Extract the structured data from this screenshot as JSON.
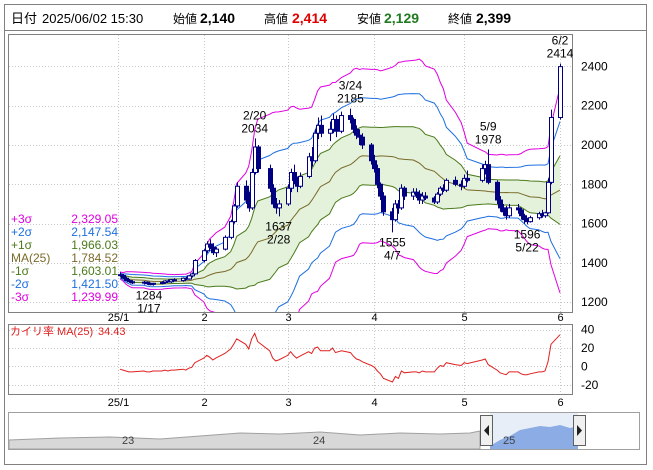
{
  "header": {
    "date_label": "日付",
    "date_value": "2025/06/02 15:30",
    "open_label": "始値",
    "open_value": "2,140",
    "high_label": "高値",
    "high_value": "2,414",
    "low_label": "安値",
    "low_value": "2,129",
    "close_label": "終値",
    "close_value": "2,399"
  },
  "bollinger_legend": [
    {
      "label": "+3σ",
      "value": "2,329.05",
      "color": "#e000e0"
    },
    {
      "label": "+2σ",
      "value": "2,147.54",
      "color": "#1e6fe0"
    },
    {
      "label": "+1σ",
      "value": "1,966.03",
      "color": "#4a7a1a"
    },
    {
      "label": "MA(25)",
      "value": "1,784.52",
      "color": "#7a6a2a"
    },
    {
      "label": "-1σ",
      "value": "1,603.01",
      "color": "#4a7a1a"
    },
    {
      "label": "-2σ",
      "value": "1,421.50",
      "color": "#1e6fe0"
    },
    {
      "label": "-3σ",
      "value": "1,239.99",
      "color": "#e000e0"
    }
  ],
  "deviation_legend": {
    "label": "カイリ率 MA(25)",
    "value": "34.43",
    "color": "#e02020"
  },
  "navigator": {
    "labels": [
      "23",
      "24",
      "25"
    ]
  },
  "chart_data": [
    {
      "type": "candlestick",
      "y_ticks": [
        "1200",
        "1400",
        "1600",
        "1800",
        "2000",
        "2200",
        "2400"
      ],
      "ylim": [
        1150,
        2560
      ],
      "x_ticks": [
        "25/1",
        "2",
        "3",
        "4",
        "5",
        "6"
      ],
      "annotations": [
        {
          "date_text": "1/17",
          "value_text": "1284",
          "x": "2025-01-17",
          "y": 1284
        },
        {
          "date_text": "2/20",
          "value_text": "2034",
          "x": "2025-02-20",
          "y": 2034
        },
        {
          "date_text": "2/28",
          "value_text": "1637",
          "x": "2025-02-28",
          "y": 1637
        },
        {
          "date_text": "3/24",
          "value_text": "2185",
          "x": "2025-03-24",
          "y": 2185
        },
        {
          "date_text": "4/7",
          "value_text": "1555",
          "x": "2025-04-07",
          "y": 1555
        },
        {
          "date_text": "5/9",
          "value_text": "1978",
          "x": "2025-05-09",
          "y": 1978
        },
        {
          "date_text": "5/22",
          "value_text": "1596",
          "x": "2025-05-22",
          "y": 1596
        },
        {
          "date_text": "6/2",
          "value_text": "2414",
          "x": "2025-06-02",
          "y": 2414
        }
      ],
      "candles": [
        {
          "date": "2025-01-06",
          "o": 1340,
          "h": 1352,
          "l": 1330,
          "c": 1336
        },
        {
          "date": "2025-01-07",
          "o": 1336,
          "h": 1344,
          "l": 1318,
          "c": 1322
        },
        {
          "date": "2025-01-08",
          "o": 1322,
          "h": 1330,
          "l": 1306,
          "c": 1310
        },
        {
          "date": "2025-01-09",
          "o": 1310,
          "h": 1318,
          "l": 1298,
          "c": 1304
        },
        {
          "date": "2025-01-10",
          "o": 1304,
          "h": 1312,
          "l": 1292,
          "c": 1298
        },
        {
          "date": "2025-01-14",
          "o": 1298,
          "h": 1308,
          "l": 1290,
          "c": 1302
        },
        {
          "date": "2025-01-15",
          "o": 1302,
          "h": 1306,
          "l": 1288,
          "c": 1294
        },
        {
          "date": "2025-01-16",
          "o": 1294,
          "h": 1300,
          "l": 1286,
          "c": 1292
        },
        {
          "date": "2025-01-17",
          "o": 1292,
          "h": 1298,
          "l": 1284,
          "c": 1296
        },
        {
          "date": "2025-01-20",
          "o": 1296,
          "h": 1306,
          "l": 1290,
          "c": 1300
        },
        {
          "date": "2025-01-21",
          "o": 1300,
          "h": 1312,
          "l": 1294,
          "c": 1308
        },
        {
          "date": "2025-01-22",
          "o": 1308,
          "h": 1316,
          "l": 1300,
          "c": 1304
        },
        {
          "date": "2025-01-23",
          "o": 1304,
          "h": 1318,
          "l": 1298,
          "c": 1314
        },
        {
          "date": "2025-01-24",
          "o": 1314,
          "h": 1322,
          "l": 1306,
          "c": 1310
        },
        {
          "date": "2025-01-27",
          "o": 1310,
          "h": 1326,
          "l": 1304,
          "c": 1322
        },
        {
          "date": "2025-01-28",
          "o": 1322,
          "h": 1330,
          "l": 1312,
          "c": 1318
        },
        {
          "date": "2025-01-29",
          "o": 1318,
          "h": 1338,
          "l": 1314,
          "c": 1334
        },
        {
          "date": "2025-01-30",
          "o": 1334,
          "h": 1350,
          "l": 1326,
          "c": 1344
        },
        {
          "date": "2025-01-31",
          "o": 1344,
          "h": 1420,
          "l": 1340,
          "c": 1412
        },
        {
          "date": "2025-02-03",
          "o": 1412,
          "h": 1470,
          "l": 1402,
          "c": 1462
        },
        {
          "date": "2025-02-04",
          "o": 1462,
          "h": 1510,
          "l": 1450,
          "c": 1496
        },
        {
          "date": "2025-02-05",
          "o": 1496,
          "h": 1520,
          "l": 1470,
          "c": 1480
        },
        {
          "date": "2025-02-06",
          "o": 1480,
          "h": 1500,
          "l": 1440,
          "c": 1452
        },
        {
          "date": "2025-02-07",
          "o": 1452,
          "h": 1480,
          "l": 1430,
          "c": 1470
        },
        {
          "date": "2025-02-10",
          "o": 1470,
          "h": 1540,
          "l": 1464,
          "c": 1530
        },
        {
          "date": "2025-02-12",
          "o": 1530,
          "h": 1620,
          "l": 1520,
          "c": 1610
        },
        {
          "date": "2025-02-13",
          "o": 1610,
          "h": 1700,
          "l": 1600,
          "c": 1690
        },
        {
          "date": "2025-02-14",
          "o": 1690,
          "h": 1810,
          "l": 1680,
          "c": 1790
        },
        {
          "date": "2025-02-17",
          "o": 1790,
          "h": 1820,
          "l": 1700,
          "c": 1720
        },
        {
          "date": "2025-02-18",
          "o": 1720,
          "h": 1760,
          "l": 1660,
          "c": 1680
        },
        {
          "date": "2025-02-19",
          "o": 1680,
          "h": 1880,
          "l": 1670,
          "c": 1860
        },
        {
          "date": "2025-02-20",
          "o": 1860,
          "h": 2034,
          "l": 1850,
          "c": 1990
        },
        {
          "date": "2025-02-21",
          "o": 1990,
          "h": 2000,
          "l": 1860,
          "c": 1880
        },
        {
          "date": "2025-02-25",
          "o": 1880,
          "h": 1900,
          "l": 1760,
          "c": 1780
        },
        {
          "date": "2025-02-26",
          "o": 1780,
          "h": 1800,
          "l": 1680,
          "c": 1700
        },
        {
          "date": "2025-02-27",
          "o": 1700,
          "h": 1730,
          "l": 1650,
          "c": 1680
        },
        {
          "date": "2025-02-28",
          "o": 1680,
          "h": 1720,
          "l": 1637,
          "c": 1700
        },
        {
          "date": "2025-03-03",
          "o": 1700,
          "h": 1800,
          "l": 1690,
          "c": 1780
        },
        {
          "date": "2025-03-04",
          "o": 1780,
          "h": 1880,
          "l": 1760,
          "c": 1860
        },
        {
          "date": "2025-03-05",
          "o": 1860,
          "h": 1900,
          "l": 1800,
          "c": 1820
        },
        {
          "date": "2025-03-06",
          "o": 1820,
          "h": 1840,
          "l": 1760,
          "c": 1790
        },
        {
          "date": "2025-03-07",
          "o": 1790,
          "h": 1860,
          "l": 1780,
          "c": 1840
        },
        {
          "date": "2025-03-10",
          "o": 1840,
          "h": 1960,
          "l": 1830,
          "c": 1940
        },
        {
          "date": "2025-03-11",
          "o": 1940,
          "h": 1990,
          "l": 1890,
          "c": 1920
        },
        {
          "date": "2025-03-12",
          "o": 1920,
          "h": 2080,
          "l": 1910,
          "c": 2060
        },
        {
          "date": "2025-03-13",
          "o": 2060,
          "h": 2140,
          "l": 2030,
          "c": 2100
        },
        {
          "date": "2025-03-14",
          "o": 2100,
          "h": 2150,
          "l": 2040,
          "c": 2060
        },
        {
          "date": "2025-03-17",
          "o": 2060,
          "h": 2120,
          "l": 2020,
          "c": 2080
        },
        {
          "date": "2025-03-18",
          "o": 2080,
          "h": 2160,
          "l": 2060,
          "c": 2130
        },
        {
          "date": "2025-03-19",
          "o": 2130,
          "h": 2150,
          "l": 2040,
          "c": 2070
        },
        {
          "date": "2025-03-21",
          "o": 2070,
          "h": 2170,
          "l": 2060,
          "c": 2150
        },
        {
          "date": "2025-03-24",
          "o": 2150,
          "h": 2185,
          "l": 2110,
          "c": 2130
        },
        {
          "date": "2025-03-25",
          "o": 2130,
          "h": 2140,
          "l": 2060,
          "c": 2080
        },
        {
          "date": "2025-03-26",
          "o": 2080,
          "h": 2100,
          "l": 2030,
          "c": 2050
        },
        {
          "date": "2025-03-27",
          "o": 2050,
          "h": 2080,
          "l": 2000,
          "c": 2040
        },
        {
          "date": "2025-03-28",
          "o": 2040,
          "h": 2060,
          "l": 1980,
          "c": 2000
        },
        {
          "date": "2025-03-31",
          "o": 2000,
          "h": 2010,
          "l": 1900,
          "c": 1920
        },
        {
          "date": "2025-04-01",
          "o": 1920,
          "h": 1950,
          "l": 1860,
          "c": 1880
        },
        {
          "date": "2025-04-02",
          "o": 1880,
          "h": 1900,
          "l": 1780,
          "c": 1800
        },
        {
          "date": "2025-04-03",
          "o": 1800,
          "h": 1810,
          "l": 1720,
          "c": 1740
        },
        {
          "date": "2025-04-04",
          "o": 1740,
          "h": 1760,
          "l": 1640,
          "c": 1660
        },
        {
          "date": "2025-04-07",
          "o": 1660,
          "h": 1680,
          "l": 1555,
          "c": 1620
        },
        {
          "date": "2025-04-08",
          "o": 1620,
          "h": 1720,
          "l": 1610,
          "c": 1700
        },
        {
          "date": "2025-04-09",
          "o": 1700,
          "h": 1720,
          "l": 1650,
          "c": 1680
        },
        {
          "date": "2025-04-10",
          "o": 1680,
          "h": 1800,
          "l": 1670,
          "c": 1780
        },
        {
          "date": "2025-04-11",
          "o": 1780,
          "h": 1790,
          "l": 1720,
          "c": 1740
        },
        {
          "date": "2025-04-14",
          "o": 1740,
          "h": 1780,
          "l": 1720,
          "c": 1760
        },
        {
          "date": "2025-04-15",
          "o": 1760,
          "h": 1780,
          "l": 1730,
          "c": 1750
        },
        {
          "date": "2025-04-16",
          "o": 1750,
          "h": 1770,
          "l": 1700,
          "c": 1720
        },
        {
          "date": "2025-04-17",
          "o": 1720,
          "h": 1760,
          "l": 1700,
          "c": 1740
        },
        {
          "date": "2025-04-18",
          "o": 1740,
          "h": 1760,
          "l": 1720,
          "c": 1730
        },
        {
          "date": "2025-04-21",
          "o": 1730,
          "h": 1740,
          "l": 1700,
          "c": 1710
        },
        {
          "date": "2025-04-22",
          "o": 1710,
          "h": 1760,
          "l": 1700,
          "c": 1750
        },
        {
          "date": "2025-04-23",
          "o": 1750,
          "h": 1790,
          "l": 1740,
          "c": 1780
        },
        {
          "date": "2025-04-24",
          "o": 1780,
          "h": 1800,
          "l": 1760,
          "c": 1770
        },
        {
          "date": "2025-04-25",
          "o": 1770,
          "h": 1830,
          "l": 1760,
          "c": 1820
        },
        {
          "date": "2025-04-28",
          "o": 1820,
          "h": 1840,
          "l": 1790,
          "c": 1800
        },
        {
          "date": "2025-04-30",
          "o": 1800,
          "h": 1820,
          "l": 1770,
          "c": 1790
        },
        {
          "date": "2025-05-01",
          "o": 1790,
          "h": 1850,
          "l": 1780,
          "c": 1830
        },
        {
          "date": "2025-05-02",
          "o": 1830,
          "h": 1870,
          "l": 1810,
          "c": 1820
        },
        {
          "date": "2025-05-07",
          "o": 1820,
          "h": 1900,
          "l": 1810,
          "c": 1880
        },
        {
          "date": "2025-05-08",
          "o": 1880,
          "h": 1920,
          "l": 1850,
          "c": 1900
        },
        {
          "date": "2025-05-09",
          "o": 1900,
          "h": 1978,
          "l": 1800,
          "c": 1810
        },
        {
          "date": "2025-05-12",
          "o": 1810,
          "h": 1820,
          "l": 1700,
          "c": 1720
        },
        {
          "date": "2025-05-13",
          "o": 1720,
          "h": 1740,
          "l": 1660,
          "c": 1680
        },
        {
          "date": "2025-05-14",
          "o": 1680,
          "h": 1700,
          "l": 1640,
          "c": 1660
        },
        {
          "date": "2025-05-15",
          "o": 1660,
          "h": 1690,
          "l": 1620,
          "c": 1640
        },
        {
          "date": "2025-05-16",
          "o": 1640,
          "h": 1700,
          "l": 1630,
          "c": 1680
        },
        {
          "date": "2025-05-19",
          "o": 1680,
          "h": 1700,
          "l": 1650,
          "c": 1670
        },
        {
          "date": "2025-05-20",
          "o": 1670,
          "h": 1680,
          "l": 1620,
          "c": 1640
        },
        {
          "date": "2025-05-21",
          "o": 1640,
          "h": 1650,
          "l": 1600,
          "c": 1620
        },
        {
          "date": "2025-05-22",
          "o": 1620,
          "h": 1630,
          "l": 1596,
          "c": 1610
        },
        {
          "date": "2025-05-23",
          "o": 1610,
          "h": 1640,
          "l": 1605,
          "c": 1630
        },
        {
          "date": "2025-05-26",
          "o": 1630,
          "h": 1660,
          "l": 1620,
          "c": 1650
        },
        {
          "date": "2025-05-27",
          "o": 1650,
          "h": 1670,
          "l": 1630,
          "c": 1640
        },
        {
          "date": "2025-05-28",
          "o": 1640,
          "h": 1660,
          "l": 1630,
          "c": 1655
        },
        {
          "date": "2025-05-29",
          "o": 1655,
          "h": 1830,
          "l": 1650,
          "c": 1810
        },
        {
          "date": "2025-05-30",
          "o": 1810,
          "h": 2180,
          "l": 1800,
          "c": 2140
        },
        {
          "date": "2025-06-02",
          "o": 2140,
          "h": 2414,
          "l": 2129,
          "c": 2399
        }
      ]
    },
    {
      "type": "line",
      "series_name": "カイリ率 MA(25)",
      "y_ticks": [
        "40",
        "20",
        "0",
        "-20"
      ],
      "ylim": [
        -30,
        45
      ],
      "values": [
        -3,
        -4,
        -5,
        -6,
        -6,
        -5,
        -6,
        -6,
        -5,
        -5,
        -4,
        -5,
        -4,
        -4,
        -3,
        -4,
        -2,
        -1,
        4,
        9,
        12,
        10,
        7,
        9,
        14,
        19,
        24,
        30,
        24,
        19,
        30,
        36,
        27,
        17,
        9,
        6,
        7,
        12,
        16,
        12,
        9,
        11,
        16,
        14,
        20,
        21,
        17,
        17,
        20,
        15,
        17,
        15,
        11,
        8,
        7,
        5,
        1,
        -1,
        -5,
        -8,
        -13,
        -17,
        -11,
        -13,
        -5,
        -7,
        -6,
        -6,
        -7,
        -5,
        -6,
        -6,
        -2,
        1,
        0,
        4,
        2,
        1,
        4,
        3,
        7,
        8,
        2,
        -4,
        -7,
        -8,
        -9,
        -6,
        -6,
        -8,
        -9,
        -9,
        -8,
        -6,
        -6,
        -5,
        5,
        24,
        34.43
      ]
    }
  ]
}
